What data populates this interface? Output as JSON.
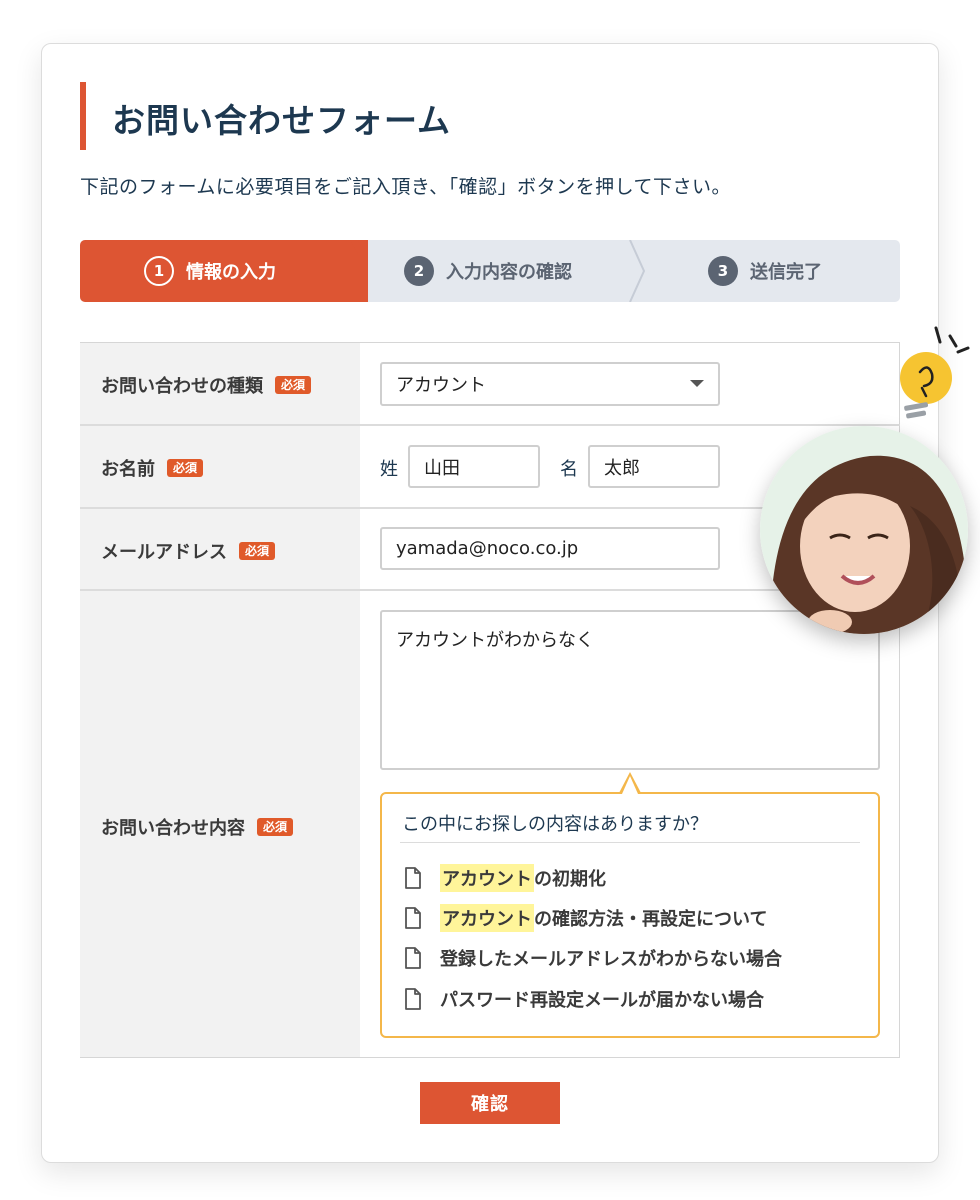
{
  "form": {
    "title": "お問い合わせフォーム",
    "lead": "下記のフォームに必要項目をご記入頂き、「確認」ボタンを押して下さい。"
  },
  "steps": [
    {
      "number": "1",
      "label": "情報の入力",
      "active": true
    },
    {
      "number": "2",
      "label": "入力内容の確認",
      "active": false
    },
    {
      "number": "3",
      "label": "送信完了",
      "active": false
    }
  ],
  "fields": {
    "required_badge": "必須",
    "inquiry_type": {
      "label": "お問い合わせの種類",
      "value": "アカウント"
    },
    "name": {
      "label": "お名前",
      "last_label": "姓",
      "last_value": "山田",
      "first_label": "名",
      "first_value": "太郎"
    },
    "email": {
      "label": "メールアドレス",
      "value": "yamada@noco.co.jp"
    },
    "content": {
      "label": "お問い合わせ内容",
      "value": "アカウントがわからなく"
    }
  },
  "suggestions": {
    "heading": "この中にお探しの内容はありますか？",
    "items": [
      {
        "highlight": "アカウント",
        "rest": "の初期化"
      },
      {
        "highlight": "アカウント",
        "rest": "の確認方法・再設定について"
      },
      {
        "highlight": "",
        "rest": "登録したメールアドレスがわからない場合"
      },
      {
        "highlight": "",
        "rest": "パスワード再設定メールが届かない場合"
      }
    ]
  },
  "confirm_button": "確認",
  "colors": {
    "accent": "#dd5533",
    "title_text": "#1d3850",
    "suggestion_border": "#f4b74a",
    "highlight": "#fff59a"
  },
  "icons": [
    "document-icon",
    "select-caret-icon",
    "lightbulb-icon"
  ]
}
